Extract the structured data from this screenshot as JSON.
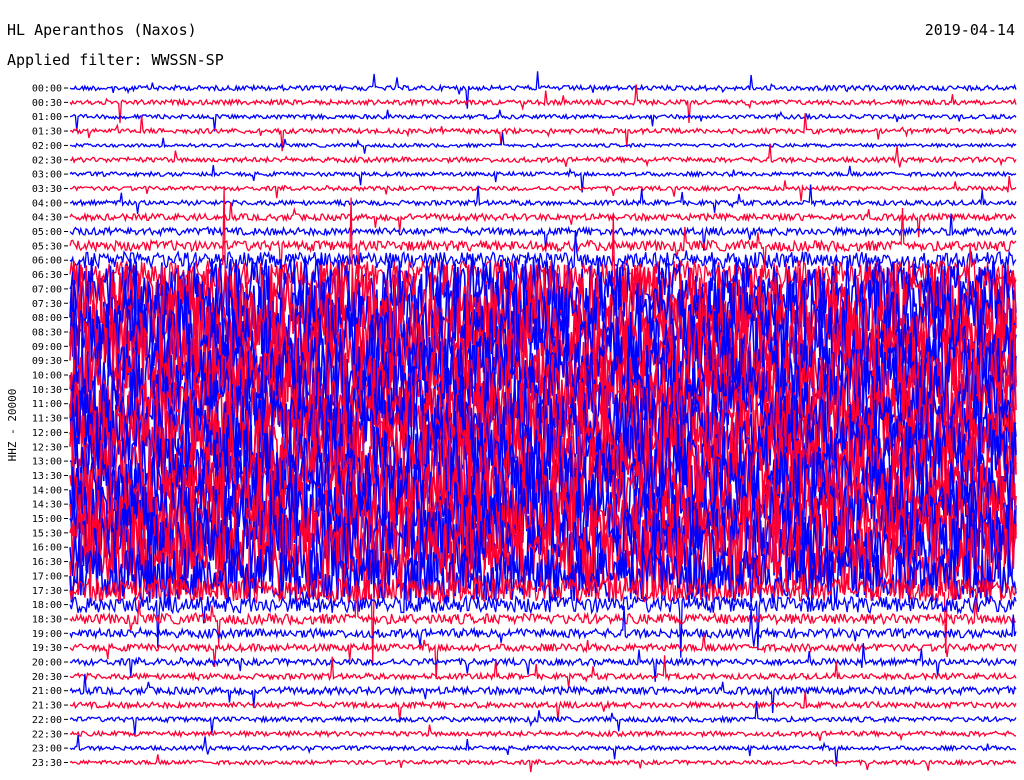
{
  "header": {
    "station": "HL Aperanthos (Naxos)",
    "date": "2019-04-14",
    "filter": "Applied filter: WWSSN-SP"
  },
  "chart_data": {
    "type": "helicorder",
    "title": "HL Aperanthos (Naxos)",
    "ylabel": "HHZ - 20000",
    "rows": [
      "00:00",
      "00:30",
      "01:00",
      "01:30",
      "02:00",
      "02:30",
      "03:00",
      "03:30",
      "04:00",
      "04:30",
      "05:00",
      "05:30",
      "06:00",
      "06:30",
      "07:00",
      "07:30",
      "08:00",
      "08:30",
      "09:00",
      "09:30",
      "10:00",
      "10:30",
      "11:00",
      "11:30",
      "12:00",
      "12:30",
      "13:00",
      "13:30",
      "14:00",
      "14:30",
      "15:00",
      "15:30",
      "16:00",
      "16:30",
      "17:00",
      "17:30",
      "18:00",
      "18:30",
      "19:00",
      "19:30",
      "20:00",
      "20:30",
      "21:00",
      "21:30",
      "22:00",
      "22:30",
      "23:00",
      "23:30"
    ],
    "trace_colors": [
      "#0000ff",
      "#ff0033"
    ],
    "relative_noise_amplitude": [
      0.05,
      0.05,
      0.04,
      0.05,
      0.03,
      0.05,
      0.04,
      0.04,
      0.05,
      0.07,
      0.08,
      0.12,
      0.2,
      0.35,
      0.8,
      1,
      1,
      1,
      1,
      1,
      1,
      1,
      1,
      1,
      1,
      1,
      1,
      1,
      1,
      1,
      1,
      1,
      1,
      1,
      0.7,
      0.3,
      0.2,
      0.12,
      0.1,
      0.08,
      0.07,
      0.06,
      0.08,
      0.06,
      0.05,
      0.05,
      0.04,
      0.04
    ],
    "grid": false
  }
}
